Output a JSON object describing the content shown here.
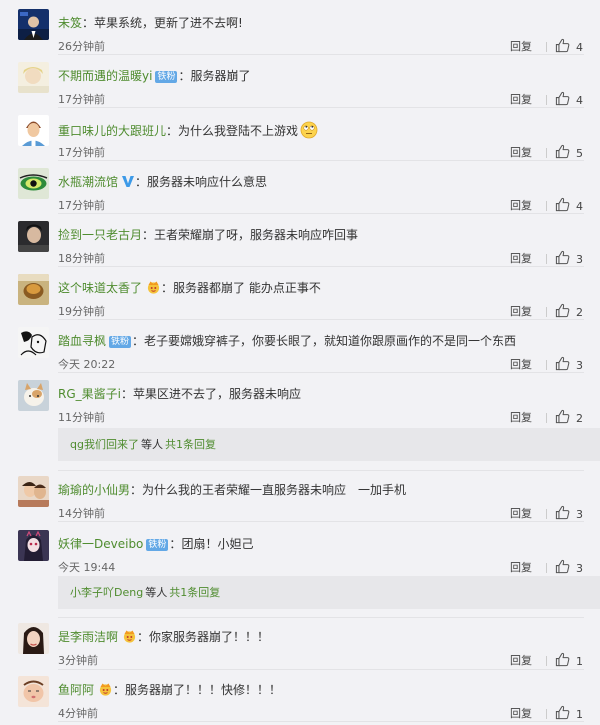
{
  "comments": [
    {
      "user": "未笈",
      "badge": "",
      "text": "苹果系统，更新了进不去啊!",
      "time": "26分钟前",
      "reply": "回复",
      "likes": "4"
    },
    {
      "user": "不期而遇的温暖yi",
      "badge": "铁粉",
      "text": "服务器崩了",
      "time": "17分钟前",
      "reply": "回复",
      "likes": "4"
    },
    {
      "user": "重口味儿的大跟班儿",
      "badge": "",
      "text": "为什么我登陆不上游戏",
      "time": "17分钟前",
      "reply": "回复",
      "likes": "5"
    },
    {
      "user": "水瓶潮流馆",
      "badge": "",
      "text": "服务器未响应什么意思",
      "time": "17分钟前",
      "reply": "回复",
      "likes": "4"
    },
    {
      "user": "捡到一只老古月",
      "badge": "",
      "text": "王者荣耀崩了呀，服务器未响应咋回事",
      "time": "18分钟前",
      "reply": "回复",
      "likes": "3"
    },
    {
      "user": "这个味道太香了",
      "badge": "",
      "text": "服务器都崩了 能办点正事不",
      "time": "19分钟前",
      "reply": "回复",
      "likes": "2"
    },
    {
      "user": "踏血寻枫",
      "badge": "铁粉",
      "text": "老子要嫦娥穿裤子，你要长眼了，就知道你跟原画作的不是同一个东西",
      "time": "今天 20:22",
      "reply": "回复",
      "likes": "3"
    },
    {
      "user": "RG_果酱子i",
      "badge": "",
      "text": "苹果区进不去了，服务器未响应",
      "time": "11分钟前",
      "reply": "回复",
      "likes": "2"
    },
    {
      "user": "瑜瑜的小仙男",
      "badge": "",
      "text": "为什么我的王者荣耀一直服务器未响应　一加手机",
      "time": "14分钟前",
      "reply": "回复",
      "likes": "3"
    },
    {
      "user": "妖律一Deveibo",
      "badge": "铁粉",
      "text": "团扇！小妲己",
      "time": "今天 19:44",
      "reply": "回复",
      "likes": "3"
    },
    {
      "user": "是李雨洁啊",
      "badge": "",
      "text": "你家服务器崩了！！！",
      "time": "3分钟前",
      "reply": "回复",
      "likes": "1"
    },
    {
      "user": "鱼阿阿",
      "badge": "",
      "text": "服务器崩了！！！快修！！！",
      "time": "4分钟前",
      "reply": "回复",
      "likes": "1"
    }
  ],
  "subreplies": [
    {
      "users": "qg我们回来了",
      "mid": "等人",
      "total": "共1条回复"
    },
    {
      "users": "小李子吖Deng",
      "mid": "等人",
      "total": "共1条回复"
    }
  ],
  "colors": {
    "username": "#4f8c2f",
    "badge": "#63a8e6",
    "background": "#f2f2f5",
    "subreply_bg": "#e7e7ea"
  }
}
